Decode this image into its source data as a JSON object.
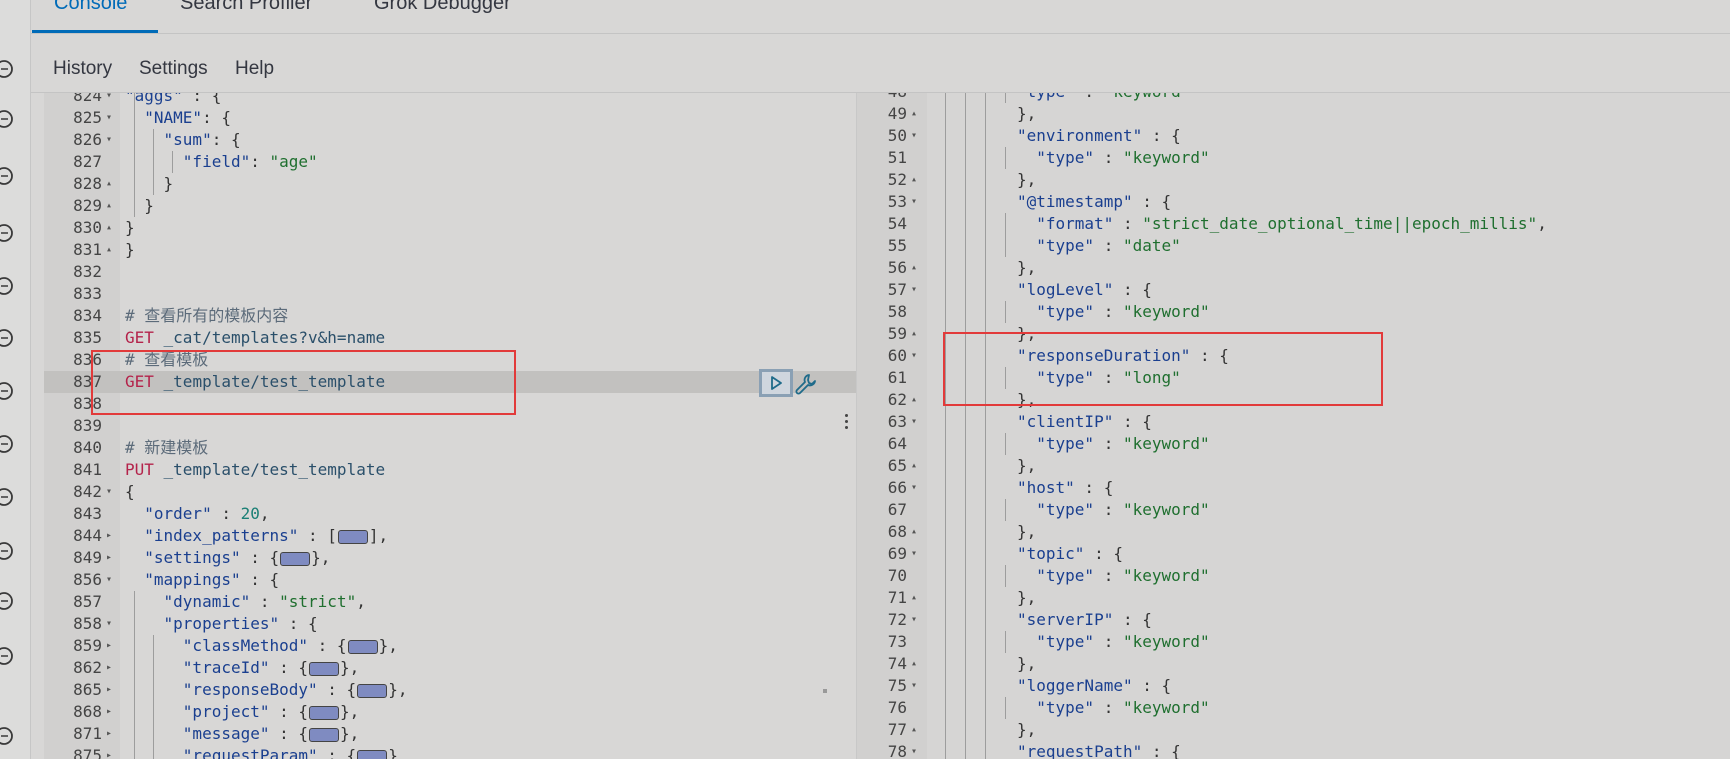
{
  "tabs": [
    {
      "label": "Console",
      "active": true
    },
    {
      "label": "Search Profiler",
      "active": false
    },
    {
      "label": "Grok Debugger",
      "active": false
    }
  ],
  "menu": [
    {
      "label": "History"
    },
    {
      "label": "Settings"
    },
    {
      "label": "Help"
    }
  ],
  "rail_icons": [
    "compass-icon",
    "dashboard-icon",
    "canvas-icon",
    "maps-icon",
    "ml-icon",
    "graph-icon",
    "observability-icon",
    "apm-icon",
    "uptime-icon",
    "siem-icon",
    "dev-tools-icon",
    "management-icon",
    "expand-icon"
  ],
  "colors": {
    "accent": "#006bb8",
    "highlight_box": "#e23a3a"
  },
  "editor": {
    "lines": [
      {
        "n": "824",
        "fold": "▾",
        "guides": 1,
        "tokens": [
          [
            "key",
            "\"aggs\""
          ],
          [
            "punct",
            " : {"
          ]
        ]
      },
      {
        "n": "825",
        "fold": "▾",
        "guides": 1,
        "tokens": [
          [
            "key",
            "  \"NAME\""
          ],
          [
            "punct",
            ": {"
          ]
        ]
      },
      {
        "n": "826",
        "fold": "▾",
        "guides": 2,
        "tokens": [
          [
            "key",
            "    \"sum\""
          ],
          [
            "punct",
            ": {"
          ]
        ]
      },
      {
        "n": "827",
        "fold": "",
        "guides": 3,
        "tokens": [
          [
            "key",
            "      \"field\""
          ],
          [
            "punct",
            ": "
          ],
          [
            "str",
            "\"age\""
          ]
        ]
      },
      {
        "n": "828",
        "fold": "▴",
        "guides": 2,
        "tokens": [
          [
            "punct",
            "    }"
          ]
        ]
      },
      {
        "n": "829",
        "fold": "▴",
        "guides": 1,
        "tokens": [
          [
            "punct",
            "  }"
          ]
        ]
      },
      {
        "n": "830",
        "fold": "▴",
        "guides": 0,
        "tokens": [
          [
            "punct",
            "}"
          ]
        ]
      },
      {
        "n": "831",
        "fold": "▴",
        "guides": 0,
        "tokens": [
          [
            "punct",
            "}"
          ]
        ]
      },
      {
        "n": "832",
        "fold": "",
        "guides": 0,
        "tokens": []
      },
      {
        "n": "833",
        "fold": "",
        "guides": 0,
        "tokens": []
      },
      {
        "n": "834",
        "fold": "",
        "guides": 0,
        "tokens": [
          [
            "comment",
            "# 查看所有的模板内容"
          ]
        ]
      },
      {
        "n": "835",
        "fold": "",
        "guides": 0,
        "tokens": [
          [
            "method",
            "GET"
          ],
          [
            "url",
            " _cat/templates?v&h=name"
          ]
        ]
      },
      {
        "n": "836",
        "fold": "",
        "guides": 0,
        "tokens": [
          [
            "comment",
            "# 查看模板"
          ]
        ]
      },
      {
        "n": "837",
        "fold": "",
        "guides": 0,
        "active": true,
        "tokens": [
          [
            "method",
            "GET"
          ],
          [
            "url",
            " _template/test_template"
          ]
        ]
      },
      {
        "n": "838",
        "fold": "",
        "guides": 0,
        "tokens": []
      },
      {
        "n": "839",
        "fold": "",
        "guides": 0,
        "tokens": []
      },
      {
        "n": "840",
        "fold": "",
        "guides": 0,
        "tokens": [
          [
            "comment",
            "# 新建模板"
          ]
        ]
      },
      {
        "n": "841",
        "fold": "",
        "guides": 0,
        "tokens": [
          [
            "method",
            "PUT"
          ],
          [
            "url",
            " _template/test_template"
          ]
        ]
      },
      {
        "n": "842",
        "fold": "▾",
        "guides": 0,
        "tokens": [
          [
            "punct",
            "{"
          ]
        ]
      },
      {
        "n": "843",
        "fold": "",
        "guides": 0,
        "tokens": [
          [
            "key",
            "  \"order\""
          ],
          [
            "punct",
            " : "
          ],
          [
            "num",
            "20"
          ],
          [
            "punct",
            ","
          ]
        ]
      },
      {
        "n": "844",
        "fold": "▸",
        "guides": 0,
        "tokens": [
          [
            "key",
            "  \"index_patterns\""
          ],
          [
            "punct",
            " : ["
          ],
          [
            "ph",
            ""
          ],
          [
            "punct",
            "],"
          ]
        ]
      },
      {
        "n": "849",
        "fold": "▸",
        "guides": 0,
        "tokens": [
          [
            "key",
            "  \"settings\""
          ],
          [
            "punct",
            " : {"
          ],
          [
            "ph",
            ""
          ],
          [
            "punct",
            "},"
          ]
        ]
      },
      {
        "n": "856",
        "fold": "▾",
        "guides": 0,
        "tokens": [
          [
            "key",
            "  \"mappings\""
          ],
          [
            "punct",
            " : {"
          ]
        ]
      },
      {
        "n": "857",
        "fold": "",
        "guides": 1,
        "tokens": [
          [
            "key",
            "    \"dynamic\""
          ],
          [
            "punct",
            " : "
          ],
          [
            "str",
            "\"strict\""
          ],
          [
            "punct",
            ","
          ]
        ]
      },
      {
        "n": "858",
        "fold": "▾",
        "guides": 1,
        "tokens": [
          [
            "key",
            "    \"properties\""
          ],
          [
            "punct",
            " : {"
          ]
        ]
      },
      {
        "n": "859",
        "fold": "▸",
        "guides": 2,
        "tokens": [
          [
            "key",
            "      \"classMethod\""
          ],
          [
            "punct",
            " : {"
          ],
          [
            "ph",
            ""
          ],
          [
            "punct",
            "},"
          ]
        ]
      },
      {
        "n": "862",
        "fold": "▸",
        "guides": 2,
        "tokens": [
          [
            "key",
            "      \"traceId\""
          ],
          [
            "punct",
            " : {"
          ],
          [
            "ph",
            ""
          ],
          [
            "punct",
            "},"
          ]
        ]
      },
      {
        "n": "865",
        "fold": "▸",
        "guides": 2,
        "tokens": [
          [
            "key",
            "      \"responseBody\""
          ],
          [
            "punct",
            " : {"
          ],
          [
            "ph",
            ""
          ],
          [
            "punct",
            "},"
          ]
        ]
      },
      {
        "n": "868",
        "fold": "▸",
        "guides": 2,
        "tokens": [
          [
            "key",
            "      \"project\""
          ],
          [
            "punct",
            " : {"
          ],
          [
            "ph",
            ""
          ],
          [
            "punct",
            "},"
          ]
        ]
      },
      {
        "n": "871",
        "fold": "▸",
        "guides": 2,
        "tokens": [
          [
            "key",
            "      \"message\""
          ],
          [
            "punct",
            " : {"
          ],
          [
            "ph",
            ""
          ],
          [
            "punct",
            "},"
          ]
        ]
      },
      {
        "n": "875",
        "fold": "▸",
        "guides": 2,
        "tokens": [
          [
            "key",
            "      \"requestParam\""
          ],
          [
            "punct",
            " : {"
          ],
          [
            "ph",
            ""
          ],
          [
            "punct",
            "}"
          ]
        ]
      }
    ]
  },
  "response": {
    "lines": [
      {
        "n": "48",
        "fold": "",
        "guides": 4,
        "tokens": [
          [
            "key",
            "\"type\""
          ],
          [
            "punct",
            " : "
          ],
          [
            "str",
            "\"keyword\""
          ]
        ]
      },
      {
        "n": "49",
        "fold": "▴",
        "guides": 3,
        "tokens": [
          [
            "punct",
            "},"
          ]
        ]
      },
      {
        "n": "50",
        "fold": "▾",
        "guides": 3,
        "tokens": [
          [
            "key",
            "\"environment\""
          ],
          [
            "punct",
            " : {"
          ]
        ]
      },
      {
        "n": "51",
        "fold": "",
        "guides": 4,
        "tokens": [
          [
            "key",
            "  \"type\""
          ],
          [
            "punct",
            " : "
          ],
          [
            "str",
            "\"keyword\""
          ]
        ]
      },
      {
        "n": "52",
        "fold": "▴",
        "guides": 3,
        "tokens": [
          [
            "punct",
            "},"
          ]
        ]
      },
      {
        "n": "53",
        "fold": "▾",
        "guides": 3,
        "tokens": [
          [
            "key",
            "\"@timestamp\""
          ],
          [
            "punct",
            " : {"
          ]
        ]
      },
      {
        "n": "54",
        "fold": "",
        "guides": 4,
        "tokens": [
          [
            "key",
            "  \"format\""
          ],
          [
            "punct",
            " : "
          ],
          [
            "str",
            "\"strict_date_optional_time||epoch_millis\""
          ],
          [
            "punct",
            ","
          ]
        ]
      },
      {
        "n": "55",
        "fold": "",
        "guides": 4,
        "tokens": [
          [
            "key",
            "  \"type\""
          ],
          [
            "punct",
            " : "
          ],
          [
            "str",
            "\"date\""
          ]
        ]
      },
      {
        "n": "56",
        "fold": "▴",
        "guides": 3,
        "tokens": [
          [
            "punct",
            "},"
          ]
        ]
      },
      {
        "n": "57",
        "fold": "▾",
        "guides": 3,
        "tokens": [
          [
            "key",
            "\"logLevel\""
          ],
          [
            "punct",
            " : {"
          ]
        ]
      },
      {
        "n": "58",
        "fold": "",
        "guides": 4,
        "tokens": [
          [
            "key",
            "  \"type\""
          ],
          [
            "punct",
            " : "
          ],
          [
            "str",
            "\"keyword\""
          ]
        ]
      },
      {
        "n": "59",
        "fold": "▴",
        "guides": 3,
        "tokens": [
          [
            "punct",
            "},"
          ]
        ]
      },
      {
        "n": "60",
        "fold": "▾",
        "guides": 3,
        "tokens": [
          [
            "key",
            "\"responseDuration\""
          ],
          [
            "punct",
            " : {"
          ]
        ]
      },
      {
        "n": "61",
        "fold": "",
        "guides": 4,
        "tokens": [
          [
            "key",
            "  \"type\""
          ],
          [
            "punct",
            " : "
          ],
          [
            "str",
            "\"long\""
          ]
        ]
      },
      {
        "n": "62",
        "fold": "▴",
        "guides": 3,
        "tokens": [
          [
            "punct",
            "},"
          ]
        ]
      },
      {
        "n": "63",
        "fold": "▾",
        "guides": 3,
        "tokens": [
          [
            "key",
            "\"clientIP\""
          ],
          [
            "punct",
            " : {"
          ]
        ]
      },
      {
        "n": "64",
        "fold": "",
        "guides": 4,
        "tokens": [
          [
            "key",
            "  \"type\""
          ],
          [
            "punct",
            " : "
          ],
          [
            "str",
            "\"keyword\""
          ]
        ]
      },
      {
        "n": "65",
        "fold": "▴",
        "guides": 3,
        "tokens": [
          [
            "punct",
            "},"
          ]
        ]
      },
      {
        "n": "66",
        "fold": "▾",
        "guides": 3,
        "tokens": [
          [
            "key",
            "\"host\""
          ],
          [
            "punct",
            " : {"
          ]
        ]
      },
      {
        "n": "67",
        "fold": "",
        "guides": 4,
        "tokens": [
          [
            "key",
            "  \"type\""
          ],
          [
            "punct",
            " : "
          ],
          [
            "str",
            "\"keyword\""
          ]
        ]
      },
      {
        "n": "68",
        "fold": "▴",
        "guides": 3,
        "tokens": [
          [
            "punct",
            "},"
          ]
        ]
      },
      {
        "n": "69",
        "fold": "▾",
        "guides": 3,
        "tokens": [
          [
            "key",
            "\"topic\""
          ],
          [
            "punct",
            " : {"
          ]
        ]
      },
      {
        "n": "70",
        "fold": "",
        "guides": 4,
        "tokens": [
          [
            "key",
            "  \"type\""
          ],
          [
            "punct",
            " : "
          ],
          [
            "str",
            "\"keyword\""
          ]
        ]
      },
      {
        "n": "71",
        "fold": "▴",
        "guides": 3,
        "tokens": [
          [
            "punct",
            "},"
          ]
        ]
      },
      {
        "n": "72",
        "fold": "▾",
        "guides": 3,
        "tokens": [
          [
            "key",
            "\"serverIP\""
          ],
          [
            "punct",
            " : {"
          ]
        ]
      },
      {
        "n": "73",
        "fold": "",
        "guides": 4,
        "tokens": [
          [
            "key",
            "  \"type\""
          ],
          [
            "punct",
            " : "
          ],
          [
            "str",
            "\"keyword\""
          ]
        ]
      },
      {
        "n": "74",
        "fold": "▴",
        "guides": 3,
        "tokens": [
          [
            "punct",
            "},"
          ]
        ]
      },
      {
        "n": "75",
        "fold": "▾",
        "guides": 3,
        "tokens": [
          [
            "key",
            "\"loggerName\""
          ],
          [
            "punct",
            " : {"
          ]
        ]
      },
      {
        "n": "76",
        "fold": "",
        "guides": 4,
        "tokens": [
          [
            "key",
            "  \"type\""
          ],
          [
            "punct",
            " : "
          ],
          [
            "str",
            "\"keyword\""
          ]
        ]
      },
      {
        "n": "77",
        "fold": "▴",
        "guides": 3,
        "tokens": [
          [
            "punct",
            "},"
          ]
        ]
      },
      {
        "n": "78",
        "fold": "▾",
        "guides": 3,
        "tokens": [
          [
            "key",
            "\"requestPath\""
          ],
          [
            "punct",
            " : {"
          ]
        ]
      }
    ]
  }
}
